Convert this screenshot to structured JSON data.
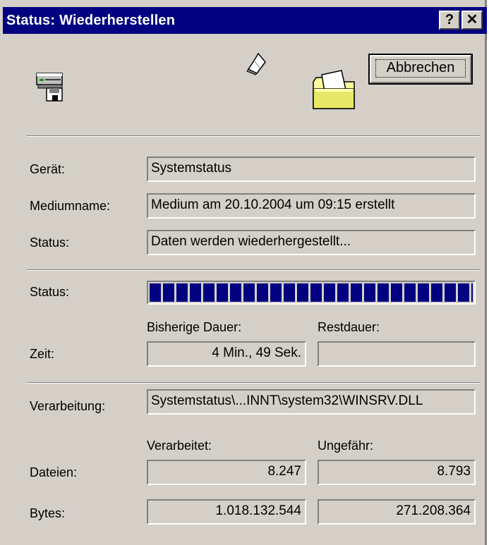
{
  "window": {
    "title": "Status: Wiederherstellen",
    "help_button": "?",
    "close_button": "✕"
  },
  "animation": {
    "source_icon": "backup-drive-icon",
    "file_icon": "flying-paper-icon",
    "target_icon": "open-folder-icon"
  },
  "cancel_button": "Abbrechen",
  "info": {
    "device_label": "Gerät:",
    "device_value": "Systemstatus",
    "medium_label": "Mediumname:",
    "medium_value": "Medium am 20.10.2004 um 09:15 erstellt",
    "status_label": "Status:",
    "status_value": "Daten werden wiederhergestellt..."
  },
  "progress": {
    "label": "Status:",
    "fraction": 1.0
  },
  "time": {
    "label": "Zeit:",
    "elapsed_header": "Bisherige Dauer:",
    "remaining_header": "Restdauer:",
    "elapsed_value": "4 Min., 49 Sek.",
    "remaining_value": ""
  },
  "processing": {
    "label": "Verarbeitung:",
    "value": "Systemstatus\\...INNT\\system32\\WINSRV.DLL"
  },
  "counts": {
    "processed_header": "Verarbeitet:",
    "estimated_header": "Ungefähr:",
    "files_label": "Dateien:",
    "files_processed": "8.247",
    "files_estimated": "8.793",
    "bytes_label": "Bytes:",
    "bytes_processed": "1.018.132.544",
    "bytes_estimated": "271.208.364"
  },
  "colors": {
    "titlebar": "#000080",
    "progress": "#000080",
    "face": "#d4d0c8"
  }
}
